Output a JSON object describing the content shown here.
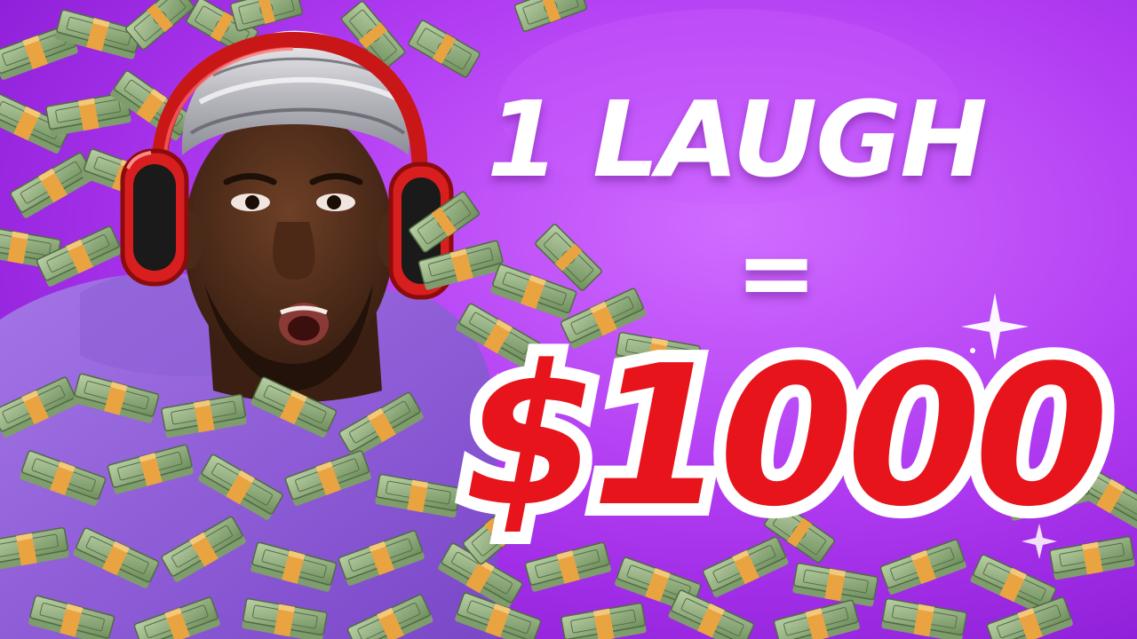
{
  "thumbnail": {
    "headline": {
      "line1": "1 LAUGH",
      "line2": "=",
      "line3": "$1000"
    }
  },
  "colors": {
    "background_purple": "#b13cf2",
    "background_light": "#d06cff",
    "headline_white": "#ffffff",
    "price_red": "#e8141c",
    "hoodie_purple": "#8f5ad8",
    "headphone_red": "#d81e1e",
    "cash_green": "#8fae7a",
    "band_orange": "#e9a441",
    "skin": "#5a3420",
    "durag_silver": "#cfcfd4"
  }
}
